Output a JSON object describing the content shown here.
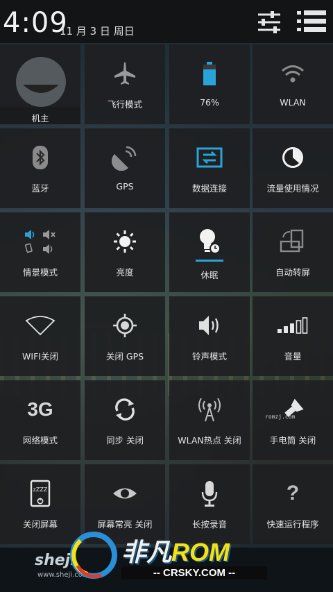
{
  "statusbar": {
    "clock": "4:09",
    "date": "11 月 3 日 周日",
    "settings_icon": "sliders-icon",
    "list_icon": "notification-list-icon"
  },
  "tiles": [
    {
      "label": "机主",
      "icon": "owner-avatar"
    },
    {
      "label": "飞行模式",
      "icon": "airplane-icon"
    },
    {
      "label": "76%",
      "icon": "battery-icon"
    },
    {
      "label": "WLAN",
      "icon": "wifi-icon"
    },
    {
      "label": "蓝牙",
      "icon": "bluetooth-icon"
    },
    {
      "label": "GPS",
      "icon": "satellite-icon"
    },
    {
      "label": "数据连接",
      "icon": "data-transfer-icon"
    },
    {
      "label": "流量使用情况",
      "icon": "usage-pie-icon"
    },
    {
      "label": "情景模式",
      "icon": "sound-profile-icon"
    },
    {
      "label": "亮度",
      "icon": "brightness-icon"
    },
    {
      "label": "休眠",
      "icon": "sleep-bulb-icon"
    },
    {
      "label": "自动转屏",
      "icon": "rotate-screen-icon"
    },
    {
      "label": "WIFI关闭",
      "icon": "wifi-off-icon"
    },
    {
      "label": "关闭 GPS",
      "icon": "gps-crosshair-icon"
    },
    {
      "label": "铃声模式",
      "icon": "ringer-icon"
    },
    {
      "label": "音量",
      "icon": "volume-bars-icon"
    },
    {
      "label": "网络模式",
      "icon": "network-3g-icon",
      "mark": "3G"
    },
    {
      "label": "同步 关闭",
      "icon": "sync-icon"
    },
    {
      "label": "WLAN热点 关闭",
      "icon": "hotspot-icon"
    },
    {
      "label": "手电筒 关闭",
      "icon": "flashlight-icon",
      "tag": "romzj.com"
    },
    {
      "label": "关闭屏幕",
      "icon": "screen-off-icon",
      "mark": "zZZZ"
    },
    {
      "label": "屏幕常亮 关闭",
      "icon": "eye-icon"
    },
    {
      "label": "长按录音",
      "icon": "microphone-icon"
    },
    {
      "label": "快速运行程序",
      "icon": "question-icon",
      "mark": "?"
    }
  ],
  "battery_level": 0.76,
  "accent_color": "#2aa3d8",
  "watermark": {
    "left_brand": "sheji",
    "left_url": "www.sheji.com",
    "brand_cn": "非凡",
    "brand_rom": "ROM",
    "brand_sub": "-- CRSKY.COM --"
  }
}
